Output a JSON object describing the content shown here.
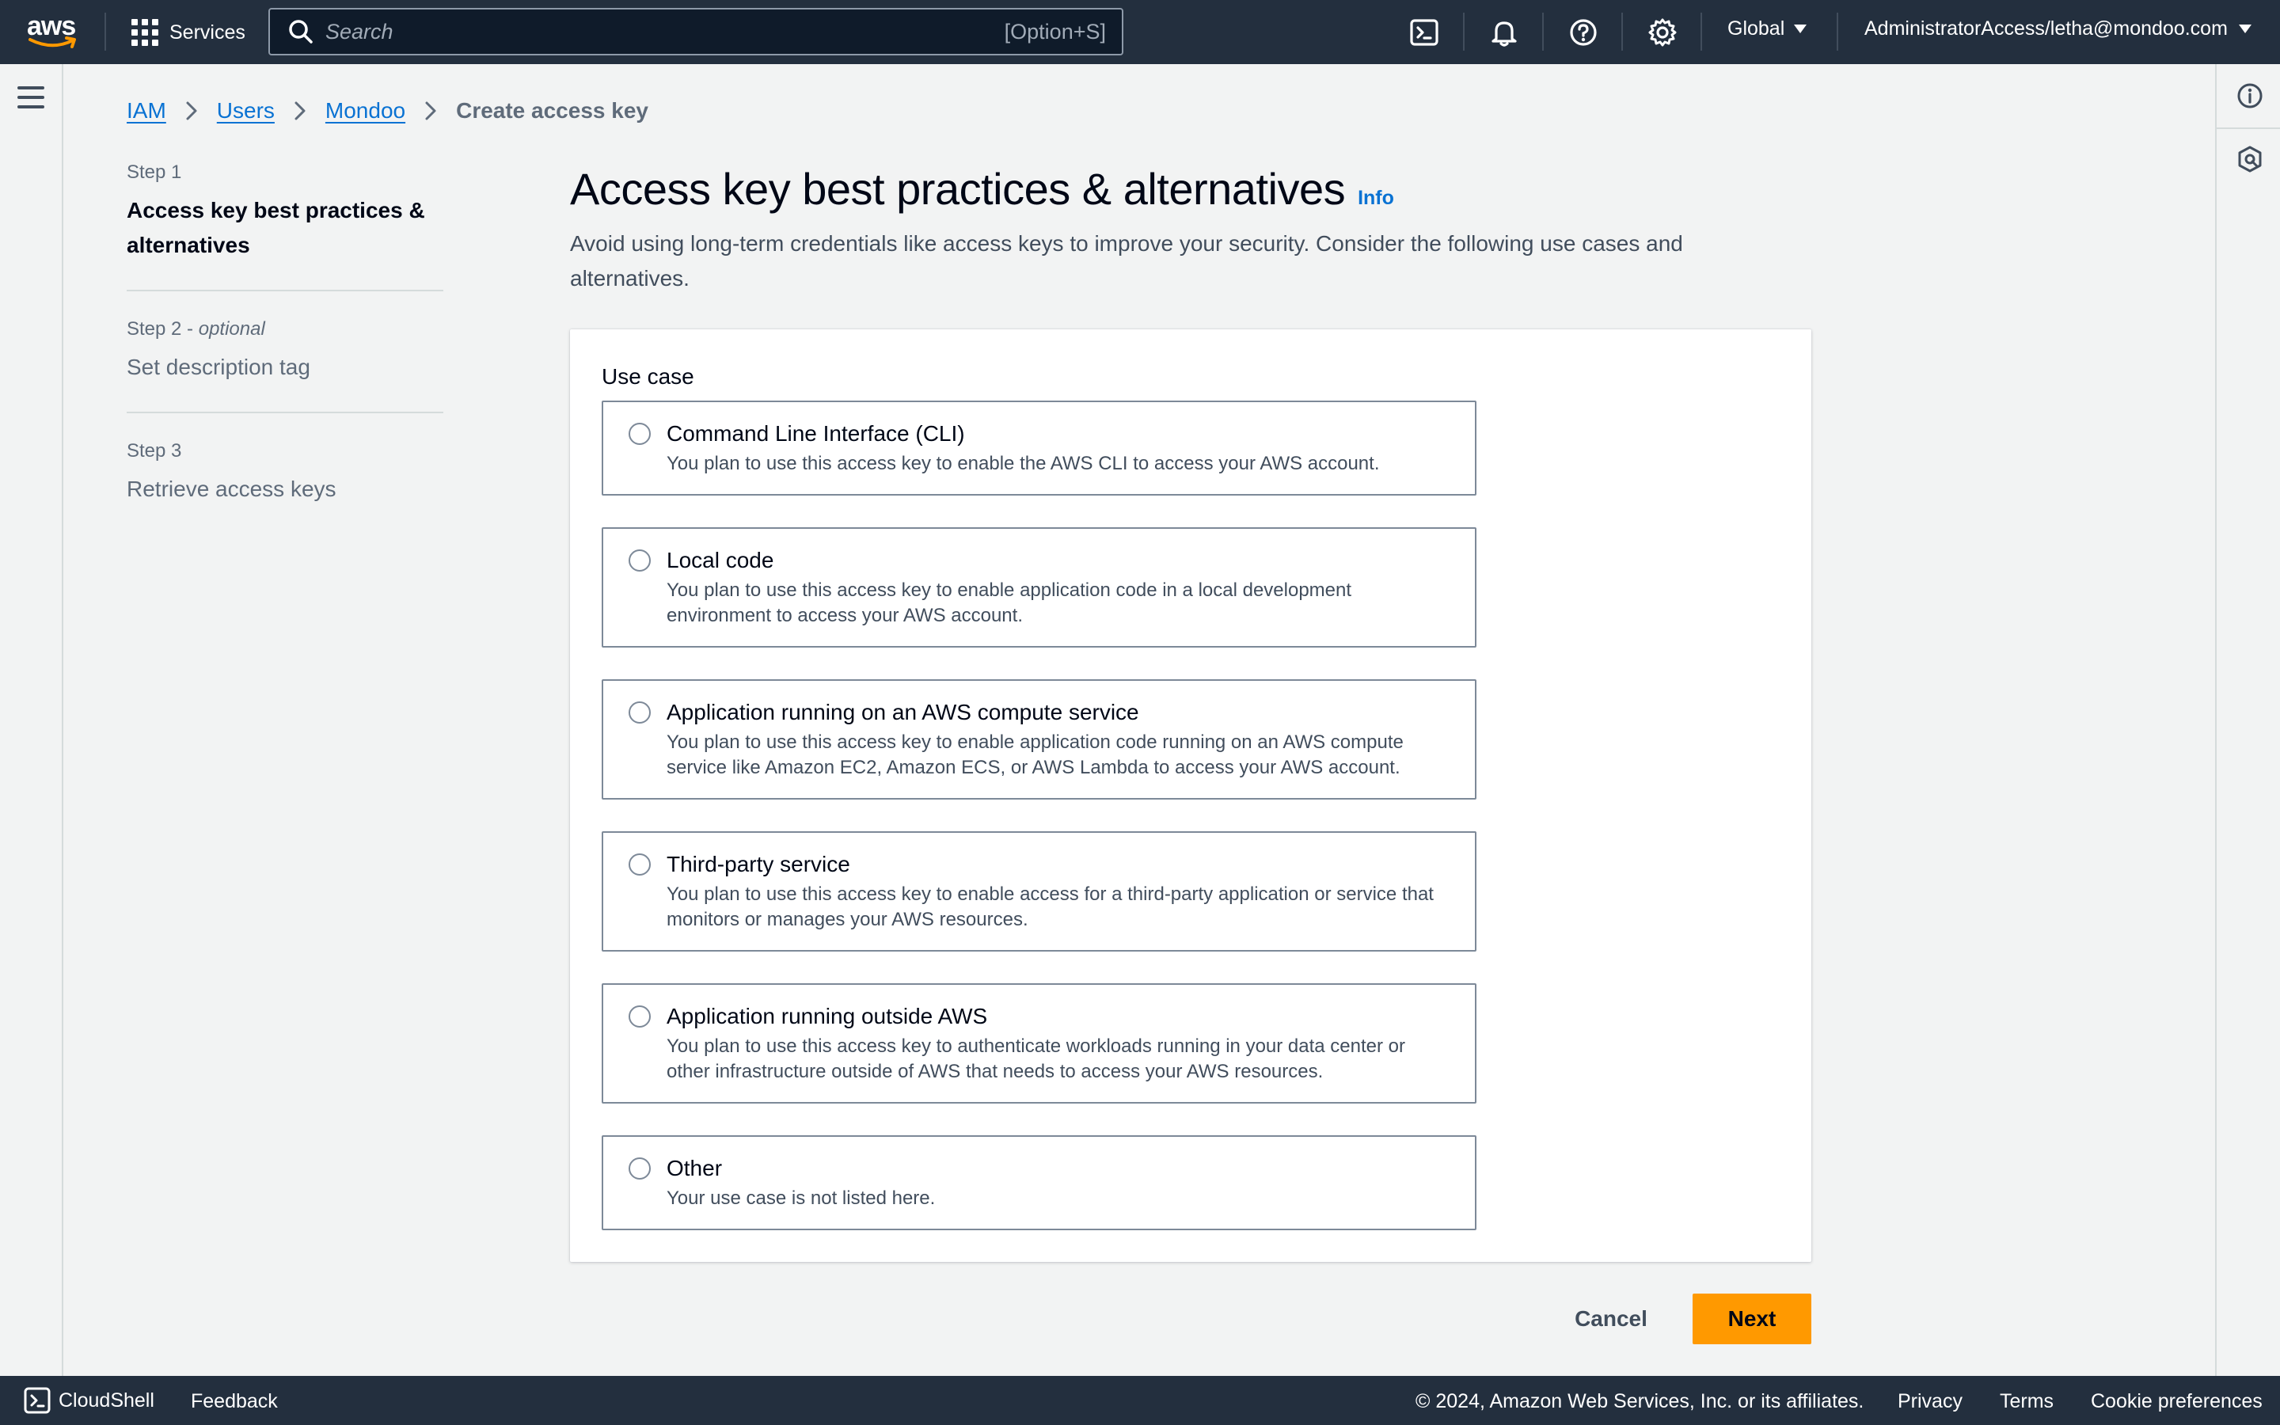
{
  "header": {
    "logo_text": "aws",
    "services_label": "Services",
    "search_placeholder": "Search",
    "search_shortcut": "[Option+S]",
    "region": "Global",
    "account": "AdministratorAccess/letha@mondoo.com",
    "icons": [
      "cloudshell-icon",
      "bell-icon",
      "help-icon",
      "gear-icon"
    ]
  },
  "breadcrumb": {
    "items": [
      "IAM",
      "Users",
      "Mondoo"
    ],
    "current": "Create access key"
  },
  "steps": [
    {
      "num": "Step 1",
      "optional": "",
      "title": "Access key best practices & alternatives"
    },
    {
      "num": "Step 2",
      "optional": "optional",
      "title": "Set description tag"
    },
    {
      "num": "Step 3",
      "optional": "",
      "title": "Retrieve access keys"
    }
  ],
  "main": {
    "title": "Access key best practices & alternatives",
    "info_link": "Info",
    "description": "Avoid using long-term credentials like access keys to improve your security. Consider the following use cases and alternatives.",
    "use_case_label": "Use case",
    "options": [
      {
        "title": "Command Line Interface (CLI)",
        "desc": "You plan to use this access key to enable the AWS CLI to access your AWS account."
      },
      {
        "title": "Local code",
        "desc": "You plan to use this access key to enable application code in a local development environment to access your AWS account."
      },
      {
        "title": "Application running on an AWS compute service",
        "desc": "You plan to use this access key to enable application code running on an AWS compute service like Amazon EC2, Amazon ECS, or AWS Lambda to access your AWS account."
      },
      {
        "title": "Third-party service",
        "desc": "You plan to use this access key to enable access for a third-party application or service that monitors or manages your AWS resources."
      },
      {
        "title": "Application running outside AWS",
        "desc": "You plan to use this access key to authenticate workloads running in your data center or other infrastructure outside of AWS that needs to access your AWS resources."
      },
      {
        "title": "Other",
        "desc": "Your use case is not listed here."
      }
    ]
  },
  "actions": {
    "cancel": "Cancel",
    "next": "Next"
  },
  "footer": {
    "cloudshell": "CloudShell",
    "feedback": "Feedback",
    "copyright": "© 2024, Amazon Web Services, Inc. or its affiliates.",
    "privacy": "Privacy",
    "terms": "Terms",
    "cookies": "Cookie preferences"
  },
  "colors": {
    "nav_bg": "#232f3e",
    "accent_link": "#0972d3",
    "primary_button": "#ff9900",
    "page_bg": "#f2f3f3"
  }
}
